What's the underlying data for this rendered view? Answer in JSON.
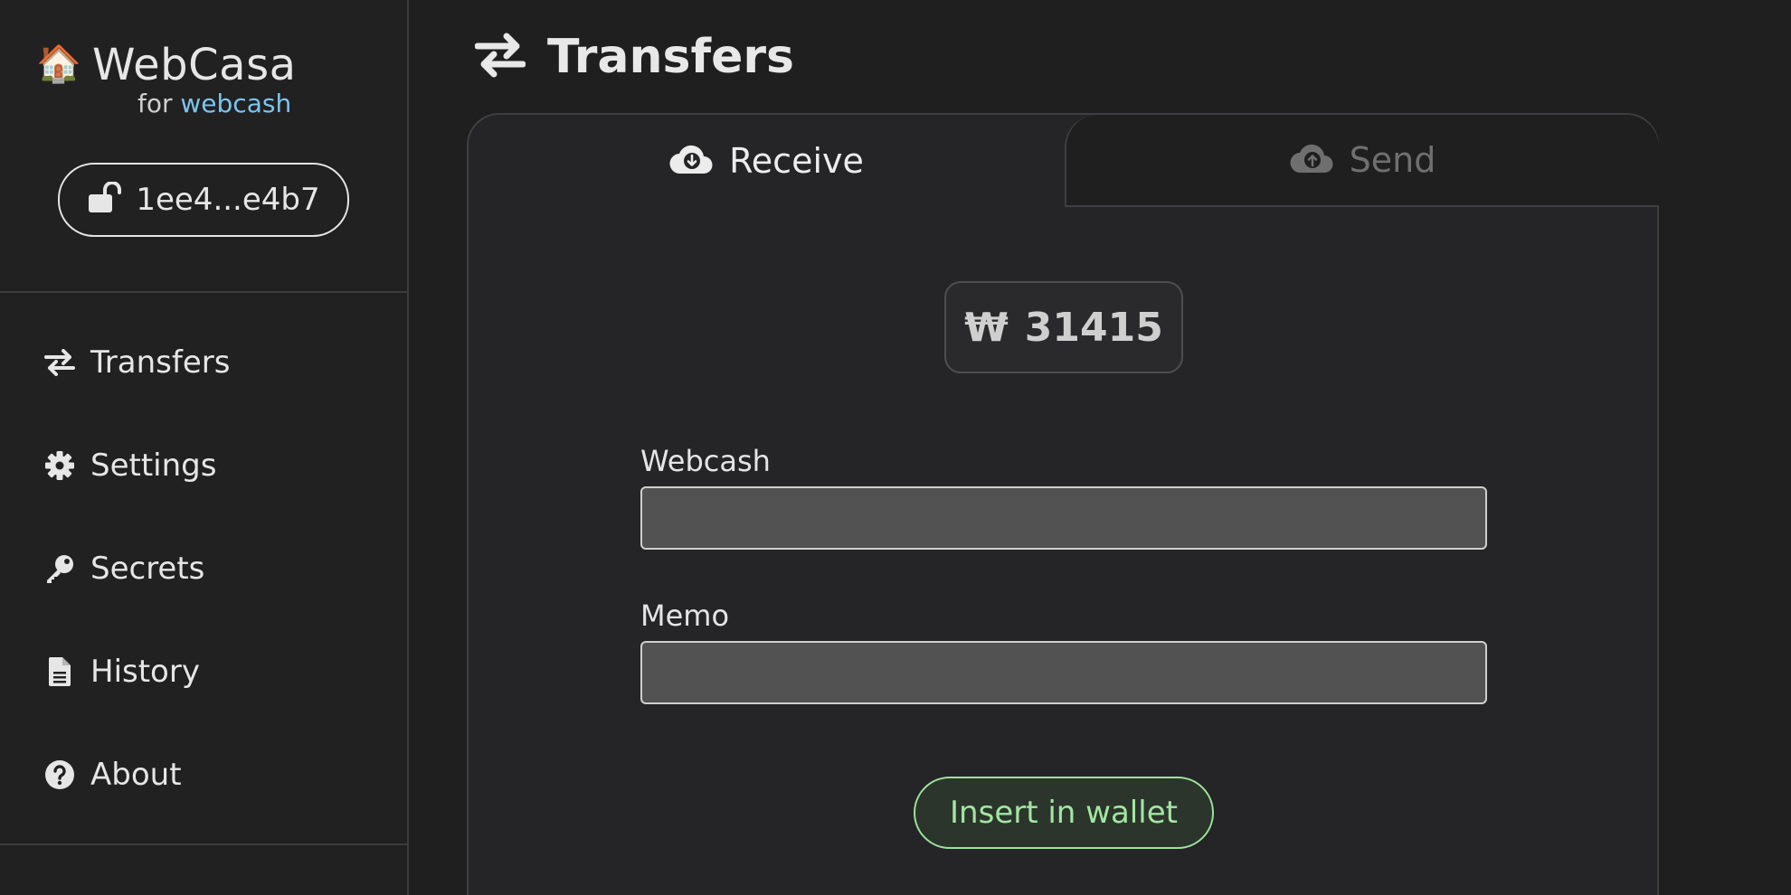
{
  "brand": {
    "logo_emoji": "🏠",
    "name": "WebCasa",
    "sub_prefix": "for",
    "sub_accent": "webcash"
  },
  "wallet": {
    "label": "1ee4...e4b7",
    "icon": "lock-open-icon"
  },
  "sidebar": {
    "items": [
      {
        "label": "Transfers",
        "icon": "transfer-arrows-icon"
      },
      {
        "label": "Settings",
        "icon": "gear-icon"
      },
      {
        "label": "Secrets",
        "icon": "key-icon"
      },
      {
        "label": "History",
        "icon": "document-icon"
      },
      {
        "label": "About",
        "icon": "question-circle-icon"
      }
    ]
  },
  "page": {
    "title": "Transfers",
    "title_icon": "transfer-arrows-icon"
  },
  "tabs": [
    {
      "label": "Receive",
      "icon": "cloud-download-icon",
      "active": true
    },
    {
      "label": "Send",
      "icon": "cloud-upload-icon",
      "active": false
    }
  ],
  "balance": {
    "currency_symbol": "₩",
    "amount": "31415"
  },
  "form": {
    "webcash_label": "Webcash",
    "webcash_value": "",
    "memo_label": "Memo",
    "memo_value": "",
    "submit_label": "Insert in wallet"
  },
  "colors": {
    "accent": "#7cc4ee",
    "submit_border": "#9be39b",
    "submit_text": "#a2e6a2",
    "background": "#1f1f20",
    "panel": "#252527"
  }
}
